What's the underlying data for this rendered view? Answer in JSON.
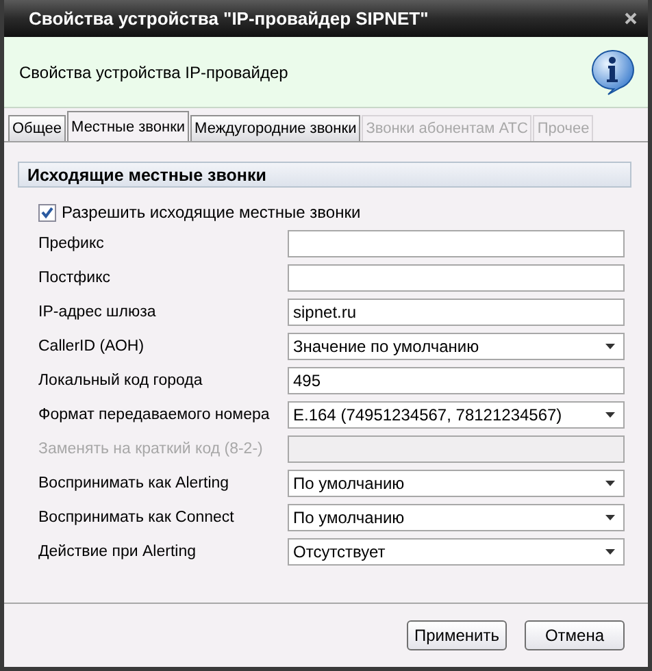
{
  "window": {
    "title": "Свойства устройства \"IP-провайдер SIPNET\""
  },
  "header": {
    "text": "Свойства устройства IP-провайдер"
  },
  "tabs": [
    {
      "label": "Общее",
      "selected": false,
      "disabled": false
    },
    {
      "label": "Местные звонки",
      "selected": true,
      "disabled": false
    },
    {
      "label": "Междугородние звонки",
      "selected": false,
      "disabled": false
    },
    {
      "label": "Звонки абонентам АТС",
      "selected": false,
      "disabled": true
    },
    {
      "label": "Прочее",
      "selected": false,
      "disabled": true
    }
  ],
  "section": {
    "title": "Исходящие местные звонки"
  },
  "allow": {
    "label": "Разрешить исходящие местные звонки",
    "checked": true
  },
  "rows": [
    {
      "label": "Префикс",
      "kind": "text",
      "disabled": false
    },
    {
      "label": "Постфикс",
      "kind": "text",
      "disabled": false
    },
    {
      "label": "IP-адрес шлюза",
      "kind": "text",
      "value": "sipnet.ru",
      "disabled": false
    },
    {
      "label": "CallerID (АОН)",
      "kind": "select",
      "value": "Значение по умолчанию",
      "disabled": false
    },
    {
      "label": "Локальный код города",
      "kind": "text",
      "value": "495",
      "disabled": false
    },
    {
      "label": "Формат передаваемого номера",
      "kind": "select",
      "value": "E.164 (74951234567, 78121234567)",
      "disabled": false
    },
    {
      "label": "Заменять на краткий код (8-2-)",
      "kind": "text",
      "disabled": true
    },
    {
      "label": "Воспринимать как Alerting",
      "kind": "select",
      "value": "По умолчанию",
      "disabled": false
    },
    {
      "label": "Воспринимать как Connect",
      "kind": "select",
      "value": "По умолчанию",
      "disabled": false
    },
    {
      "label": "Действие при Alerting",
      "kind": "select",
      "value": "Отсутствует",
      "disabled": false
    }
  ],
  "buttons": [
    {
      "label": "Применить"
    },
    {
      "label": "Отмена"
    }
  ]
}
